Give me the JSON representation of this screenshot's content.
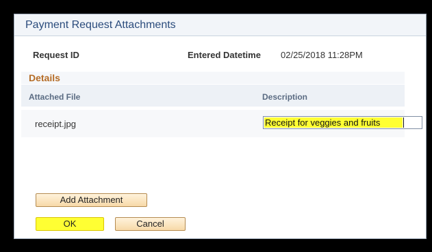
{
  "dialog": {
    "title": "Payment Request Attachments"
  },
  "header": {
    "request_id_label": "Request ID",
    "entered_datetime_label": "Entered Datetime",
    "entered_datetime_value": "02/25/2018 11:28PM"
  },
  "details": {
    "title": "Details",
    "columns": [
      "Attached File",
      "Description"
    ],
    "rows": [
      {
        "attached_file": "receipt.jpg",
        "description": "Receipt for veggies and fruits"
      }
    ]
  },
  "buttons": {
    "add_attachment": "Add Attachment",
    "ok": "OK",
    "cancel": "Cancel"
  },
  "colors": {
    "highlight": "#ffff33",
    "title_text": "#2a4b7c",
    "details_title": "#b56c26"
  }
}
